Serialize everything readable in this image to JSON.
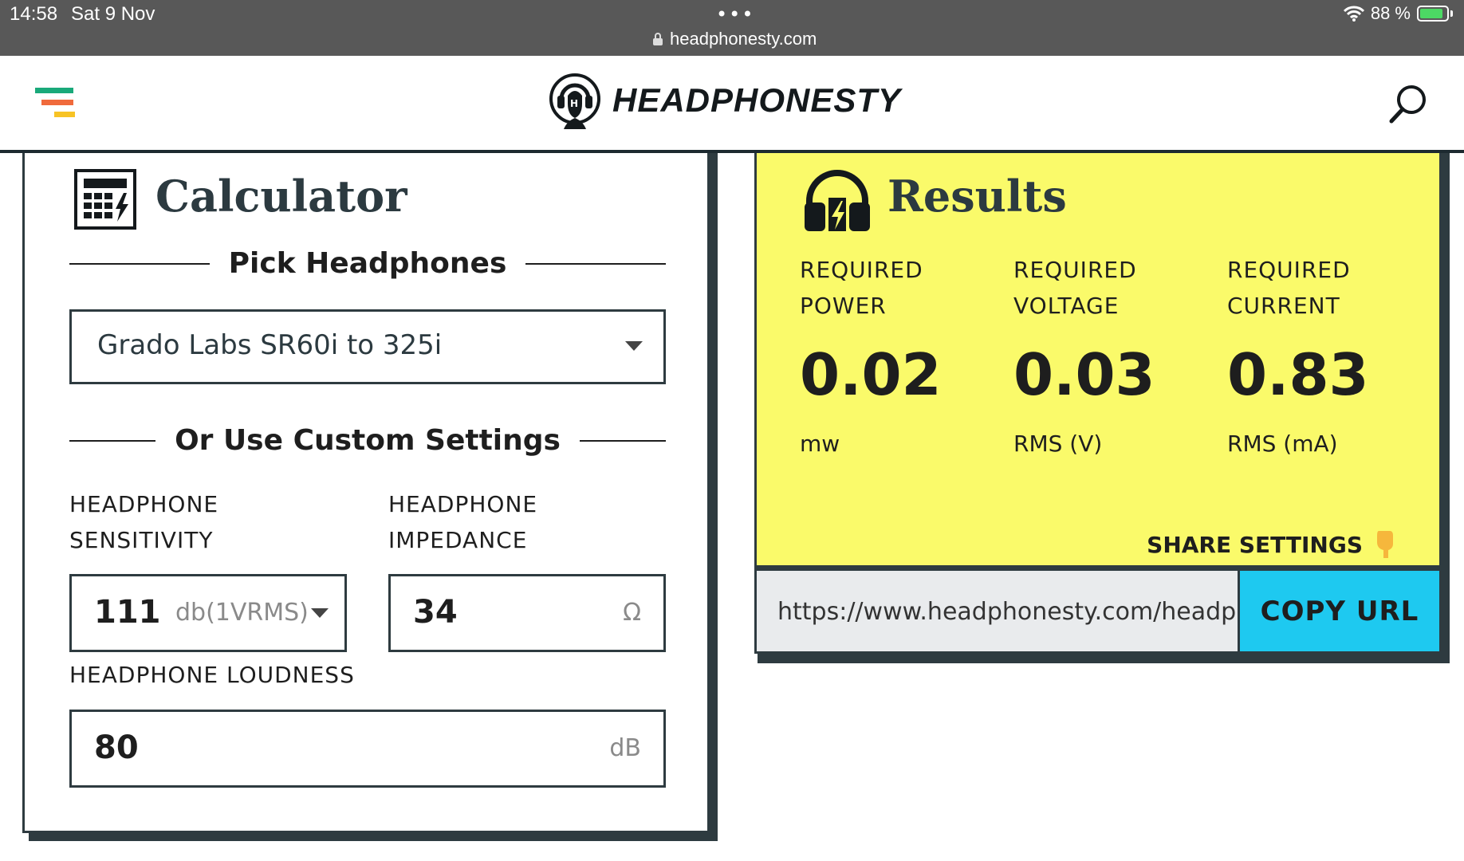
{
  "status_bar": {
    "time": "14:58",
    "date": "Sat 9 Nov",
    "url": "headphonesty.com",
    "battery": "88 %",
    "battery_level": 0.88
  },
  "header": {
    "logo_text": "HEADPHONESTY",
    "menu_colors": [
      "#1aa97a",
      "#f06a3c",
      "#f7c325"
    ]
  },
  "calculator": {
    "title": "Calculator",
    "pick_heading": "Pick Headphones",
    "selected_headphone": "Grado Labs SR60i to 325i",
    "custom_heading": "Or Use Custom Settings",
    "sensitivity_label_1": "HEADPHONE",
    "sensitivity_label_2": "SENSITIVITY",
    "impedance_label_1": "HEADPHONE",
    "impedance_label_2": "IMPEDANCE",
    "sensitivity_value": "111",
    "sensitivity_unit": "db(1VRMS)",
    "impedance_value": "34",
    "impedance_unit": "Ω",
    "loudness_label": "HEADPHONE LOUDNESS",
    "loudness_value": "80",
    "loudness_unit": "dB"
  },
  "results": {
    "title": "Results",
    "power_label_1": "REQUIRED",
    "power_label_2": "POWER",
    "power_value": "0.02",
    "power_unit": "mw",
    "voltage_label_1": "REQUIRED",
    "voltage_label_2": "VOLTAGE",
    "voltage_value": "0.03",
    "voltage_unit": "RMS (V)",
    "current_label_1": "REQUIRED",
    "current_label_2": "CURRENT",
    "current_value": "0.83",
    "current_unit": "RMS (mA)",
    "share_label": "SHARE SETTINGS",
    "share_url": "https://www.headphonesty.com/headphones/headphone-power-calculator/",
    "copy_label": "COPY URL",
    "accent_color": "#fafa6a",
    "button_color": "#1ec9f0"
  }
}
